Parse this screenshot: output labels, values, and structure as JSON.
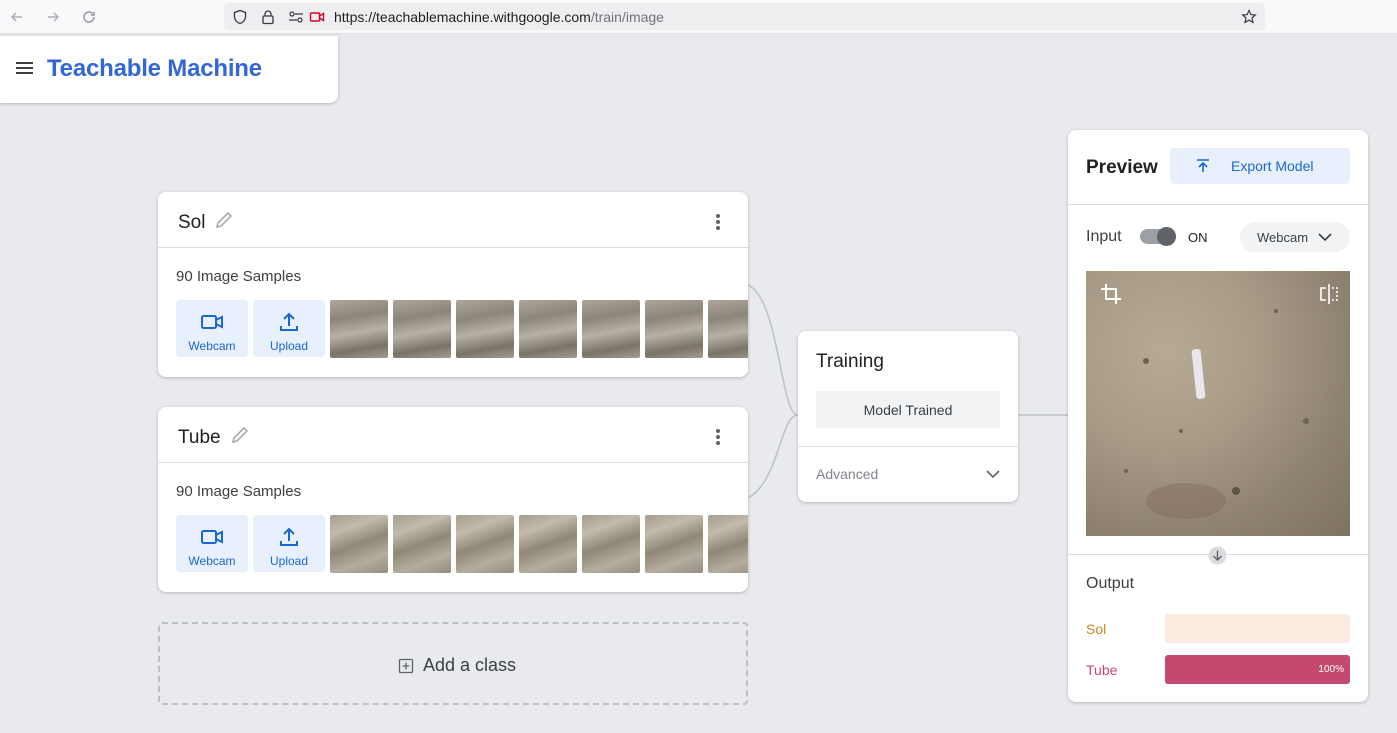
{
  "browser": {
    "url_host": "https://teachablemachine.withgoogle.com",
    "url_path": "/train/image"
  },
  "app": {
    "title": "Teachable Machine"
  },
  "classes": [
    {
      "name": "Sol",
      "sample_count": "90 Image Samples",
      "webcam_label": "Webcam",
      "upload_label": "Upload"
    },
    {
      "name": "Tube",
      "sample_count": "90 Image Samples",
      "webcam_label": "Webcam",
      "upload_label": "Upload"
    }
  ],
  "add_class_label": "Add a class",
  "training": {
    "title": "Training",
    "status_button": "Model Trained",
    "advanced_label": "Advanced"
  },
  "preview": {
    "title": "Preview",
    "export_label": "Export Model",
    "input_label": "Input",
    "toggle_state": "ON",
    "source_select": "Webcam",
    "output_label": "Output",
    "outputs": [
      {
        "name": "Sol",
        "value": 0,
        "percent_label": "",
        "color": "#c98a1e",
        "track_color": "#fbeae0"
      },
      {
        "name": "Tube",
        "value": 1.0,
        "percent_label": "100%",
        "color": "#c4496f",
        "track_color": "#f8dde6"
      }
    ]
  },
  "colors": {
    "brand": "#3367d6",
    "accent_blue": "#1967d2",
    "chip_bg": "#e8f0fe"
  }
}
